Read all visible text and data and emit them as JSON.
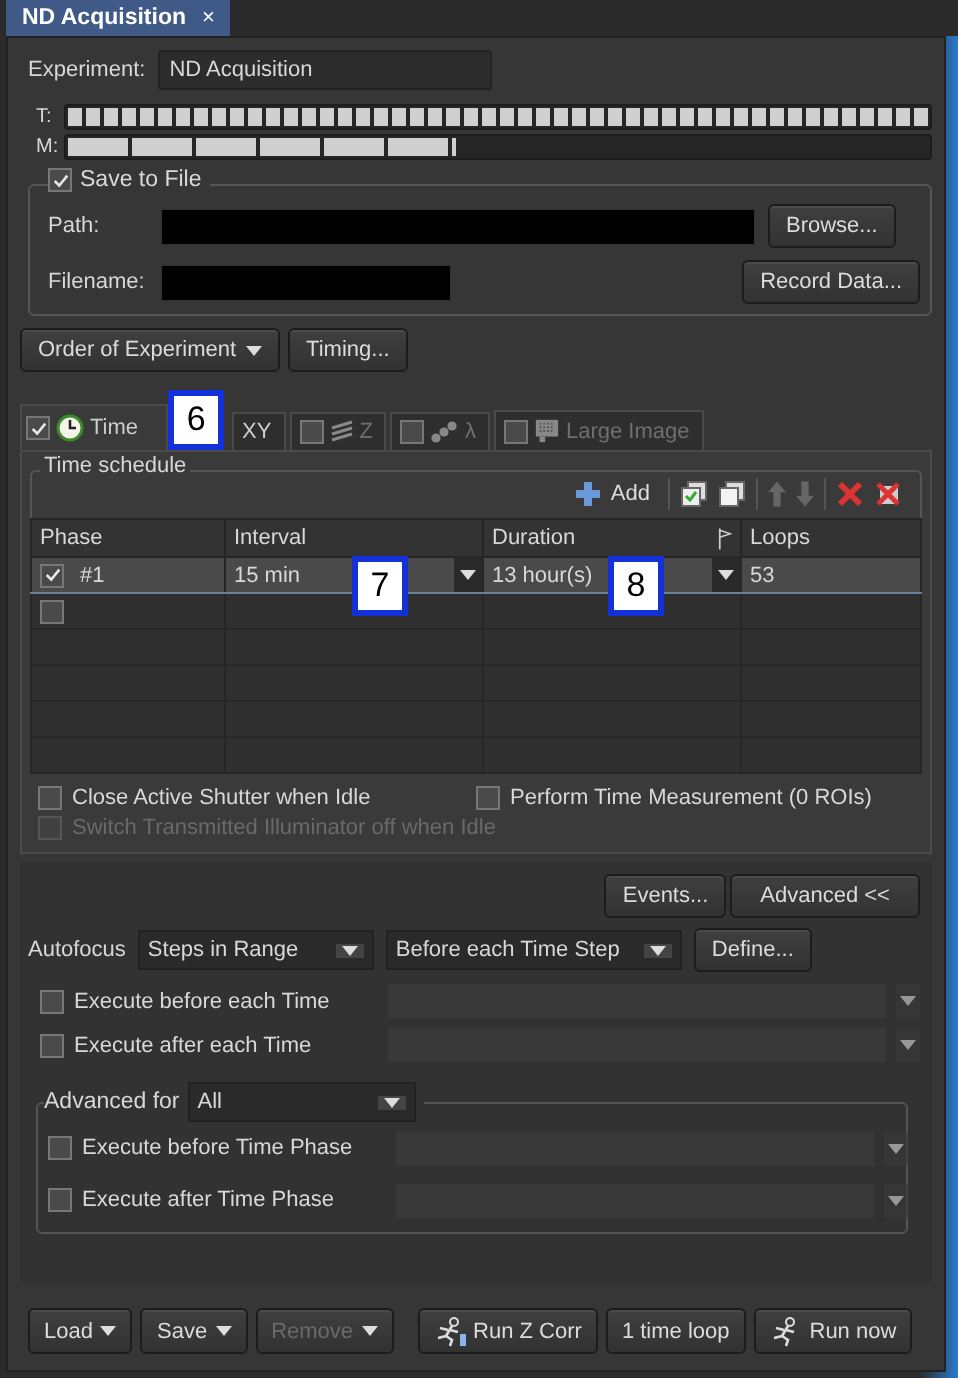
{
  "tab": {
    "title": "ND Acquisition",
    "close": "×"
  },
  "experiment": {
    "label": "Experiment:",
    "value": "ND Acquisition"
  },
  "progress": [
    {
      "label": "T:",
      "level": 1
    },
    {
      "label": "M:",
      "level": 0.45
    }
  ],
  "save_to_file": {
    "label": "Save to File",
    "checked": true,
    "path_label": "Path:",
    "filename_label": "Filename:",
    "browse_button": "Browse...",
    "record_button": "Record Data..."
  },
  "order_button": "Order of Experiment",
  "timing_button": "Timing...",
  "dimension_tabs": [
    {
      "kind": "time",
      "label": "Time",
      "checked": true,
      "selected": true,
      "disabled": false
    },
    {
      "kind": "xy",
      "label": "XY",
      "selected": false,
      "disabled": false
    },
    {
      "kind": "z",
      "label": "Z",
      "checked": false,
      "selected": false,
      "disabled": true
    },
    {
      "kind": "lambda",
      "label": "λ",
      "checked": false,
      "selected": false,
      "disabled": true
    },
    {
      "kind": "large_image",
      "label": "Large Image",
      "checked": false,
      "selected": false,
      "disabled": true
    }
  ],
  "time_schedule": {
    "title": "Time schedule",
    "add_button": "Add",
    "columns": [
      "Phase",
      "Interval",
      "Duration",
      "Loops"
    ],
    "rows": [
      {
        "checked": true,
        "selected": true,
        "phase": "#1",
        "interval": "15 min",
        "duration": "13 hour(s)",
        "loops": "53"
      },
      {
        "checked": false,
        "selected": false
      }
    ]
  },
  "options": [
    {
      "label": "Close Active Shutter when Idle",
      "checked": false,
      "disabled": false
    },
    {
      "label": "Perform Time Measurement (0 ROIs)",
      "checked": false,
      "disabled": false
    },
    {
      "label": "Switch Transmitted Illuminator off when Idle",
      "checked": false,
      "disabled": true
    }
  ],
  "events_button": "Events...",
  "advanced_button": "Advanced <<",
  "autofocus": {
    "label": "Autofocus",
    "mode": "Steps in Range",
    "timing": "Before each Time Step",
    "define_button": "Define..."
  },
  "execute": [
    {
      "label": "Execute before each Time",
      "checked": false
    },
    {
      "label": "Execute after each Time",
      "checked": false
    }
  ],
  "advanced_for": {
    "label": "Advanced for",
    "value": "All",
    "execute": [
      {
        "label": "Execute before Time Phase",
        "checked": false
      },
      {
        "label": "Execute after Time Phase",
        "checked": false
      }
    ]
  },
  "bottom_buttons": [
    {
      "kind": "dropdown",
      "label": "Load",
      "disabled": false
    },
    {
      "kind": "dropdown",
      "label": "Save",
      "disabled": false
    },
    {
      "kind": "dropdown",
      "label": "Remove",
      "disabled": true
    },
    {
      "kind": "run_z",
      "label": "Run Z Corr",
      "disabled": false
    },
    {
      "kind": "plain",
      "label": "1 time loop",
      "disabled": false
    },
    {
      "kind": "run",
      "label": "Run now",
      "disabled": false
    }
  ],
  "callouts": [
    "6",
    "7",
    "8"
  ]
}
